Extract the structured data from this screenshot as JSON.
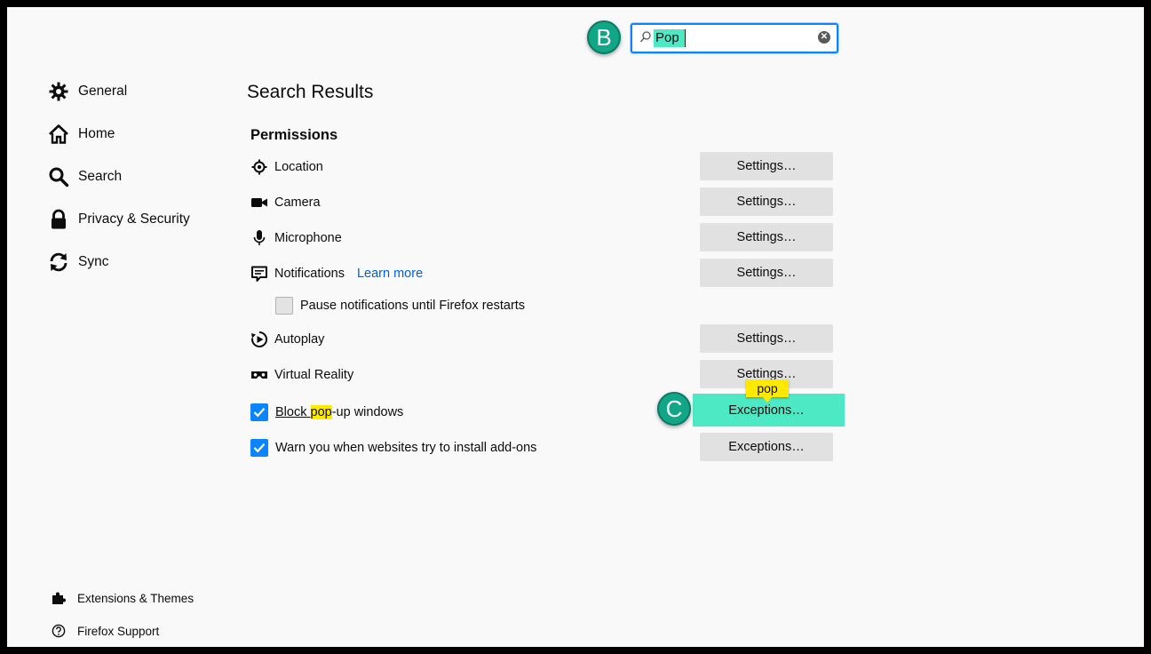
{
  "search": {
    "value": "Pop",
    "placeholder": ""
  },
  "callouts": {
    "b": "B",
    "c": "C"
  },
  "sidebar": {
    "items": [
      {
        "label": "General",
        "icon": "gear-icon"
      },
      {
        "label": "Home",
        "icon": "home-icon"
      },
      {
        "label": "Search",
        "icon": "search-icon"
      },
      {
        "label": "Privacy & Security",
        "icon": "lock-icon"
      },
      {
        "label": "Sync",
        "icon": "sync-icon"
      }
    ],
    "footer": [
      {
        "label": "Extensions & Themes",
        "icon": "puzzle-icon"
      },
      {
        "label": "Firefox Support",
        "icon": "help-icon"
      }
    ]
  },
  "main": {
    "title": "Search Results",
    "section_heading": "Permissions",
    "permissions": [
      {
        "label": "Location",
        "icon": "location-icon",
        "button": "Settings…"
      },
      {
        "label": "Camera",
        "icon": "camera-icon",
        "button": "Settings…"
      },
      {
        "label": "Microphone",
        "icon": "microphone-icon",
        "button": "Settings…"
      },
      {
        "label": "Notifications",
        "icon": "notifications-icon",
        "button": "Settings…",
        "link": "Learn more"
      },
      {
        "label": "Autoplay",
        "icon": "autoplay-icon",
        "button": "Settings…"
      },
      {
        "label": "Virtual Reality",
        "icon": "vr-icon",
        "button": "Settings…"
      }
    ],
    "pause_notifications": {
      "label": "Pause notifications until Firefox restarts",
      "checked": false
    },
    "block_popups": {
      "pre": "Block ",
      "match": "pop",
      "post": "-up windows",
      "checked": true,
      "button": "Exceptions…"
    },
    "warn_addons": {
      "label": "Warn you when websites try to install add-ons",
      "checked": true,
      "button": "Exceptions…"
    },
    "tooltip": "pop"
  },
  "colors": {
    "accent": "#0a84ff",
    "callout": "#11a686",
    "highlight": "#ffe900",
    "teal_highlight": "#4de8c4"
  }
}
